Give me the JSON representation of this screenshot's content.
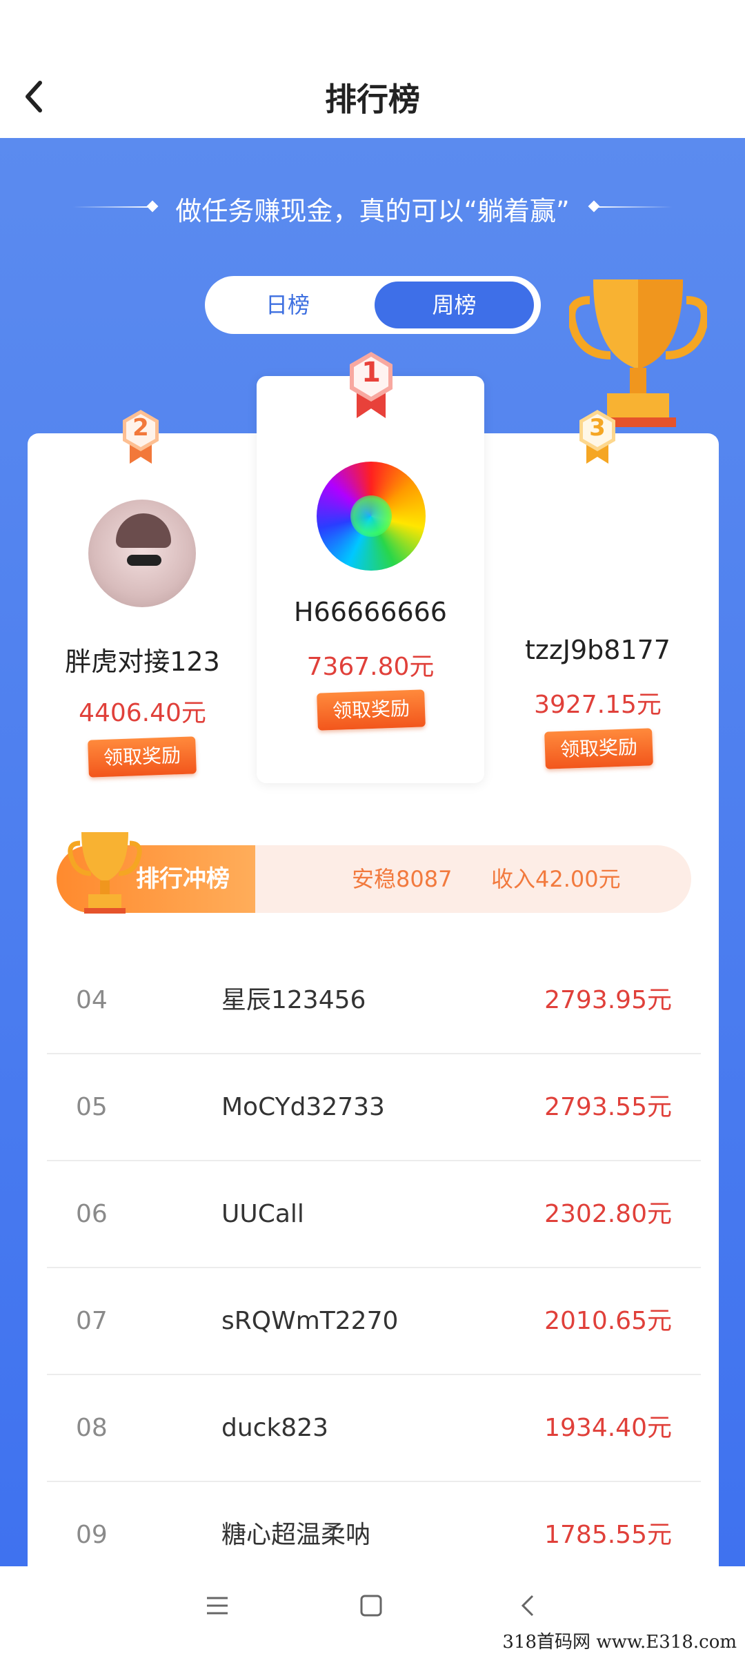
{
  "header": {
    "title": "排行榜"
  },
  "slogan": "做任务赚现金，真的可以“躺着赢”",
  "tabs": {
    "day": "日榜",
    "week": "周榜",
    "active": "周榜"
  },
  "podium": [
    {
      "rank": "1",
      "name": "H66666666",
      "amount": "7367.80元",
      "button": "领取奖励"
    },
    {
      "rank": "2",
      "name": "胖虎对接123",
      "amount": "4406.40元",
      "button": "领取奖励"
    },
    {
      "rank": "3",
      "name": "tzzJ9b8177",
      "amount": "3927.15元",
      "button": "领取奖励"
    }
  ],
  "sprint": {
    "label": "排行冲榜",
    "user": "安稳8087",
    "income": "收入42.00元"
  },
  "list": [
    {
      "rank": "04",
      "name": "星辰123456",
      "amount": "2793.95元"
    },
    {
      "rank": "05",
      "name": "MoCYd32733",
      "amount": "2793.55元"
    },
    {
      "rank": "06",
      "name": "UUCall",
      "amount": "2302.80元"
    },
    {
      "rank": "07",
      "name": "sRQWmT2270",
      "amount": "2010.65元"
    },
    {
      "rank": "08",
      "name": "duck823",
      "amount": "1934.40元"
    },
    {
      "rank": "09",
      "name": "糖心超温柔呐",
      "amount": "1785.55元"
    }
  ],
  "colors": {
    "primary_blue": "#3e6fe8",
    "amount_red": "#e0403a",
    "orange": "#f2561c"
  },
  "watermark": "318首码网 www.E318.com"
}
